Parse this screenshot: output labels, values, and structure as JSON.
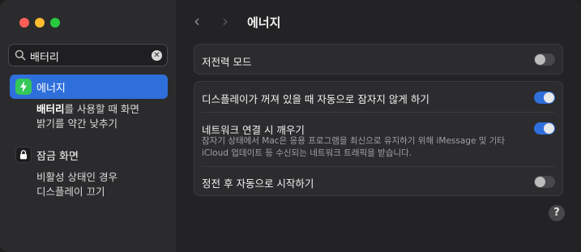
{
  "window": {
    "title": "에너지"
  },
  "search": {
    "value": "배터리"
  },
  "sidebar": {
    "items": [
      {
        "label": "에너지",
        "icon": "bolt-icon",
        "selected": true,
        "sub_results": [
          {
            "highlight": "배터리",
            "rest": "를 사용할 때 화면"
          },
          {
            "text": "밝기를 약간 낮추기"
          }
        ]
      },
      {
        "label": "잠금 화면",
        "icon": "lock-icon",
        "selected": false,
        "sub_results": [
          {
            "text": "비활성 상태인 경우"
          },
          {
            "text": "디스플레이 끄기"
          }
        ]
      }
    ]
  },
  "main": {
    "low_power_mode": {
      "label": "저전력 모드",
      "enabled": false
    },
    "settings": [
      {
        "label": "디스플레이가 꺼져 있을 때 자동으로 잠자지 않게 하기",
        "enabled": true
      },
      {
        "label": "네트워크 연결 시 깨우기",
        "description_line1": "잠자기 상태에서 Mac은 응용 프로그램을 최신으로 유지하기 위해 iMessage 및 기타",
        "description_line2": "iCloud 업데이트 등 수신되는 네트워크 트래픽을 받습니다.",
        "enabled": true
      },
      {
        "label": "정전 후 자동으로 시작하기",
        "enabled": false
      }
    ],
    "help_label": "?"
  },
  "nav": {
    "back_glyph": "‹",
    "forward_glyph": "›"
  },
  "colors": {
    "accent": "#2f6fdc",
    "toggle_off": "#48484a",
    "energy_icon": "#34c759"
  }
}
